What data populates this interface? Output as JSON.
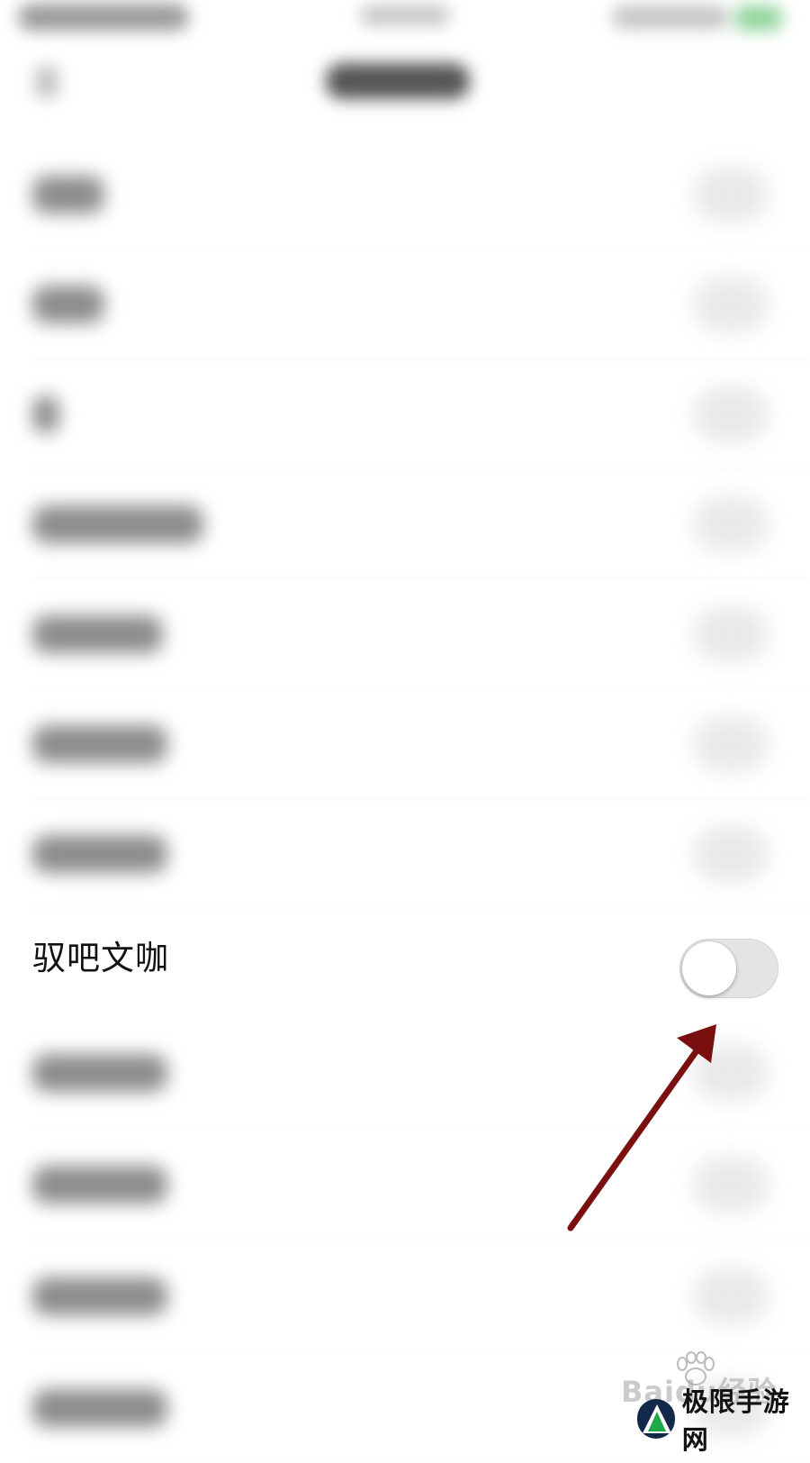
{
  "rows_top_blurred": [
    {
      "label_width": 80
    },
    {
      "label_width": 80
    },
    {
      "label_width": 30
    },
    {
      "label_width": 190
    },
    {
      "label_width": 145
    },
    {
      "label_width": 150
    },
    {
      "label_width": 150
    }
  ],
  "highlighted_row": {
    "label": "驭吧文咖",
    "toggle_state": "off"
  },
  "rows_bottom_blurred": [
    {
      "label_width": 150
    },
    {
      "label_width": 150
    },
    {
      "label_width": 150
    },
    {
      "label_width": 150
    }
  ],
  "annotation": {
    "arrow_color": "#7a0f0f"
  },
  "watermarks": {
    "baidu": "Baidu经验",
    "jixian": "极限手游网"
  }
}
